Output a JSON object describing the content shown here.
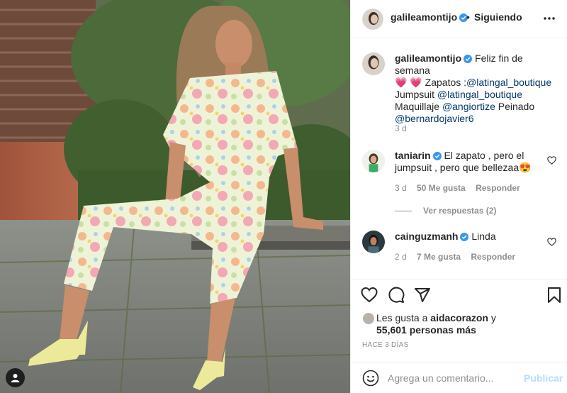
{
  "post": {
    "username": "galileamontijo",
    "verified": true,
    "follow_status": "Siguiendo",
    "separator": "•"
  },
  "caption": {
    "username": "galileamontijo",
    "text_1": "Feliz fin de semana",
    "emojis": "💗 💗",
    "text_2": "Zapatos :",
    "mention_shoes": "@latingal_boutique",
    "text_3": "Jumpsuit",
    "mention_jumpsuit": "@latingal_boutique",
    "text_4": "Maquillaje",
    "mention_makeup": "@angiortize",
    "text_5": "Peinado",
    "mention_hair": "@bernardojavier6",
    "time": "3 d"
  },
  "comments": [
    {
      "username": "taniarin",
      "verified": true,
      "text": "El zapato , pero el jumpsuit , pero que bellezaa😍",
      "time": "3 d",
      "likes": "50 Me gusta",
      "reply_label": "Responder",
      "view_replies": "Ver respuestas (2)"
    },
    {
      "username": "cainguzmanh",
      "verified": true,
      "text": "Linda",
      "time": "2 d",
      "likes": "7 Me gusta",
      "reply_label": "Responder"
    }
  ],
  "likes": {
    "prefix": "Les gusta a",
    "first_user": "aidacorazon",
    "conjunction": "y",
    "others": "55,601 personas más"
  },
  "timestamp": "HACE 3 DÍAS",
  "add_comment": {
    "placeholder": "Agrega un comentario...",
    "publish_label": "Publicar"
  },
  "icons": {
    "verified_color": "#3897f0",
    "heart": "heart-icon",
    "comment": "comment-icon",
    "share": "share-icon",
    "save": "bookmark-icon",
    "more": "more-options-icon",
    "emoji": "emoji-icon",
    "tagged_user": "user-tag-icon"
  }
}
